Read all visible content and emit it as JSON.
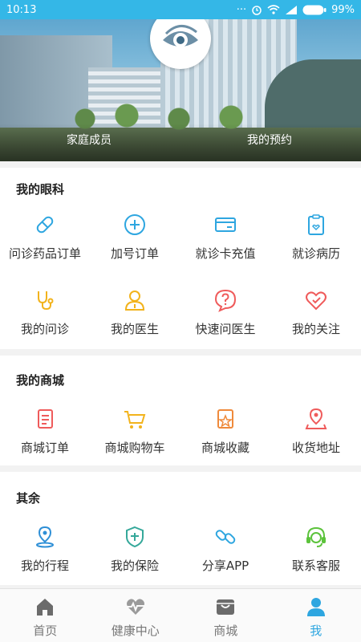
{
  "status_bar": {
    "time": "10:13",
    "battery": "99%"
  },
  "hero": {
    "family_label": "家庭成员",
    "appointment_label": "我的预约"
  },
  "sections": {
    "eye": {
      "title": "我的眼科",
      "items": [
        "问诊药品订单",
        "加号订单",
        "就诊卡充值",
        "就诊病历",
        "我的问诊",
        "我的医生",
        "快速问医生",
        "我的关注"
      ]
    },
    "mall": {
      "title": "我的商城",
      "items": [
        "商城订单",
        "商城购物车",
        "商城收藏",
        "收货地址"
      ]
    },
    "other": {
      "title": "其余",
      "items": [
        "我的行程",
        "我的保险",
        "分享APP",
        "联系客服"
      ]
    }
  },
  "tabs": [
    "首页",
    "健康中心",
    "商城",
    "我"
  ],
  "colors": {
    "accent": "#2ea6e0",
    "status_bar": "#34b7e7"
  }
}
